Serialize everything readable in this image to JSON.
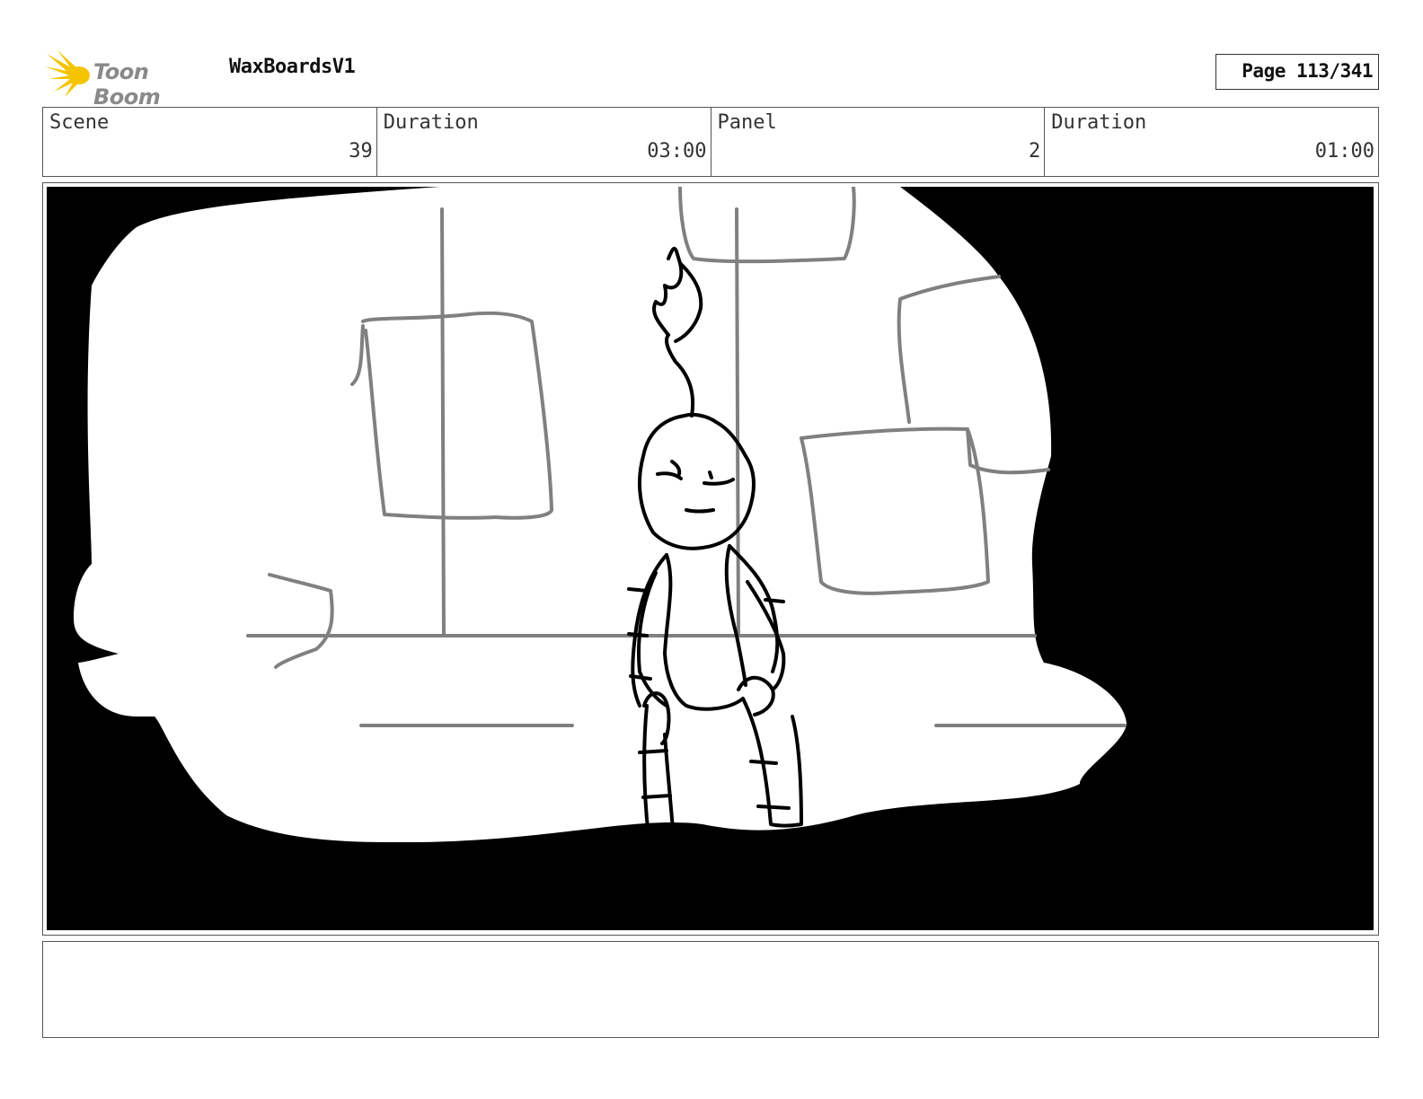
{
  "header": {
    "logo_text": "Toon Boom",
    "project_title": "WaxBoardsV1",
    "page_label": "Page 113/341"
  },
  "info": {
    "scene_label": "Scene",
    "scene_value": "39",
    "scene_duration_label": "Duration",
    "scene_duration_value": "03:00",
    "panel_label": "Panel",
    "panel_value": "2",
    "panel_duration_label": "Duration",
    "panel_duration_value": "01:00"
  },
  "notes": {
    "text": ""
  },
  "colors": {
    "logo_flame": "#f5c400",
    "panel_background": "#000000",
    "sketch_gray": "#808080"
  }
}
